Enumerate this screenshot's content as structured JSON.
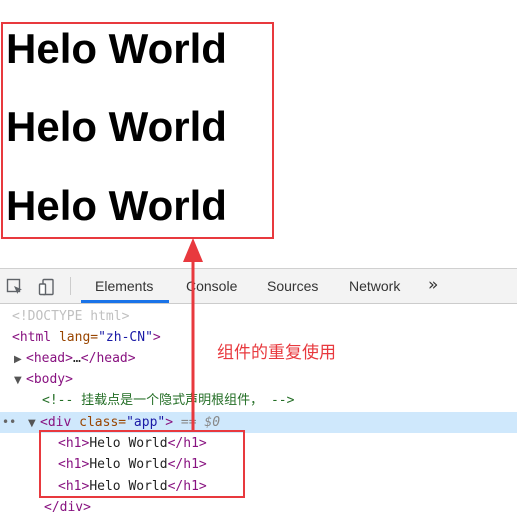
{
  "page": {
    "headings": [
      "Helo World",
      "Helo World",
      "Helo World"
    ]
  },
  "annotation": {
    "text": "组件的重复使用",
    "color": "#e8393e"
  },
  "devtools": {
    "tabs": [
      "Elements",
      "Console",
      "Sources",
      "Network"
    ],
    "active_tab": "Elements",
    "more_tabs_icon": "»",
    "accent_color": "#1a73e8",
    "icons": [
      "inspect-element-icon",
      "device-toolbar-icon",
      "more-tabs-icon"
    ],
    "dom": {
      "doctype": "<!DOCTYPE html>",
      "html_open": "<html",
      "html_attr": " lang=",
      "html_val": "\"zh-CN\"",
      "html_close": ">",
      "head_open": "<head>",
      "head_ellipsis": "…",
      "head_close": "</head>",
      "body_open": "<body>",
      "comment": "<!-- 挂载点是一个隐式声明根组件， -->",
      "div_open": "<div",
      "div_attr": " class=",
      "div_val": "\"app\"",
      "div_close": ">",
      "div_eq": " == ",
      "div_ref": "$0",
      "h1_open": "<h1>",
      "h1_text": "Helo World",
      "h1_close": "</h1>",
      "div_end": "</div>",
      "selected_dots": "••"
    }
  }
}
